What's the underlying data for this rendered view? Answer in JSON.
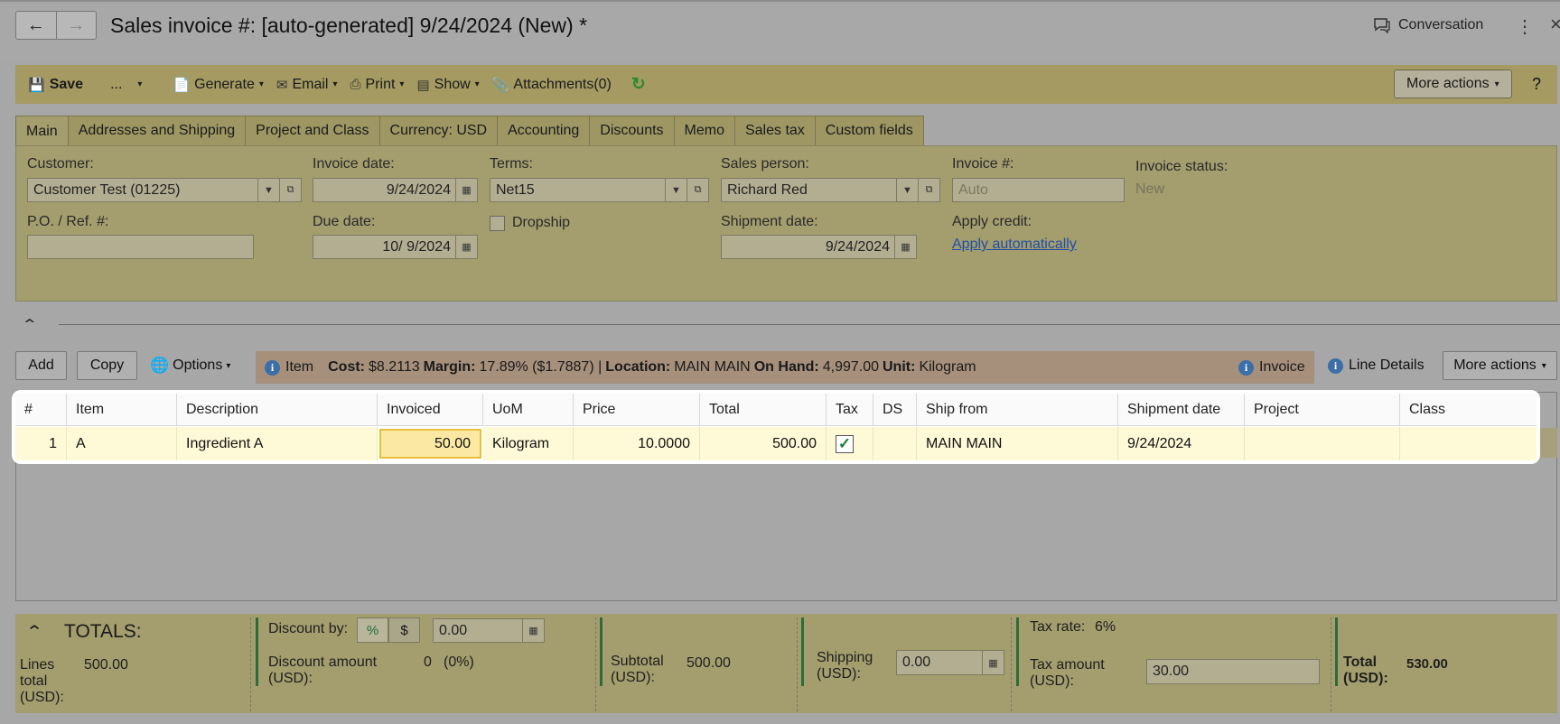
{
  "header": {
    "title": "Sales invoice #: [auto-generated] 9/24/2024 (New) *",
    "conversation": "Conversation"
  },
  "toolbar": {
    "save": "Save",
    "dots": "...",
    "generate": "Generate",
    "email": "Email",
    "print": "Print",
    "show": "Show",
    "attachments": "Attachments(0)",
    "more_actions": "More actions",
    "help": "?"
  },
  "tabs": [
    "Main",
    "Addresses and Shipping",
    "Project and Class",
    "Currency: USD",
    "Accounting",
    "Discounts",
    "Memo",
    "Sales tax",
    "Custom fields"
  ],
  "form": {
    "customer_label": "Customer:",
    "customer_value": "Customer Test (01225)",
    "invoice_date_label": "Invoice date:",
    "invoice_date_value": "9/24/2024",
    "terms_label": "Terms:",
    "terms_value": "Net15",
    "sales_person_label": "Sales person:",
    "sales_person_value": "Richard Red",
    "invoice_no_label": "Invoice #:",
    "invoice_no_placeholder": "Auto",
    "invoice_status_label": "Invoice status:",
    "invoice_status_value": "New",
    "po_label": "P.O. / Ref. #:",
    "po_value": "",
    "due_date_label": "Due date:",
    "due_date_value": "10/ 9/2024",
    "dropship_label": "Dropship",
    "shipment_date_label": "Shipment date:",
    "shipment_date_value": "9/24/2024",
    "apply_credit_label": "Apply credit:",
    "apply_credit_link": "Apply automatically"
  },
  "grid_toolbar": {
    "add": "Add",
    "copy": "Copy",
    "options": "Options",
    "item_tab": "Item",
    "cost_label": "Cost:",
    "cost_value": "$8.2113",
    "margin_label": "Margin:",
    "margin_value": "17.89% ($1.7887) |",
    "location_label": "Location:",
    "location_value": "MAIN MAIN",
    "onhand_label": "On Hand:",
    "onhand_value": "4,997.00",
    "unit_label": "Unit:",
    "unit_value": "Kilogram",
    "invoice_tab": "Invoice",
    "line_details": "Line Details",
    "more_actions": "More actions"
  },
  "table": {
    "columns": [
      "#",
      "Item",
      "Description",
      "Invoiced",
      "UoM",
      "Price",
      "Total",
      "Tax",
      "DS",
      "Ship from",
      "Shipment date",
      "Project",
      "Class"
    ],
    "rows": [
      {
        "no": "1",
        "item": "A",
        "description": "Ingredient A",
        "invoiced": "50.00",
        "uom": "Kilogram",
        "price": "10.0000",
        "total": "500.00",
        "tax": "✓",
        "ds": "",
        "ship_from": "MAIN MAIN",
        "shipment_date": "9/24/2024",
        "project": "",
        "class": ""
      }
    ]
  },
  "totals": {
    "heading": "TOTALS:",
    "lines_total_label": "Lines total (USD):",
    "lines_total_value": "500.00",
    "discount_by_label": "Discount by:",
    "pct": "%",
    "usd": "$",
    "discount_input": "0.00",
    "discount_amount_label": "Discount amount (USD):",
    "discount_amount_value": "0",
    "discount_pct": "(0%)",
    "subtotal_label": "Subtotal (USD):",
    "subtotal_value": "500.00",
    "shipping_label": "Shipping (USD):",
    "shipping_value": "0.00",
    "tax_rate_label": "Tax rate:",
    "tax_rate_value": "6%",
    "tax_amount_label": "Tax amount (USD):",
    "tax_amount_value": "30.00",
    "total_label": "Total (USD):",
    "total_value": "530.00"
  },
  "colors": {
    "toolbar": "#a49a62",
    "panel": "#a49d6e",
    "highlight_row": "#fef9d6",
    "link": "#1f4fa8",
    "accent_green": "#2f6b3a"
  }
}
